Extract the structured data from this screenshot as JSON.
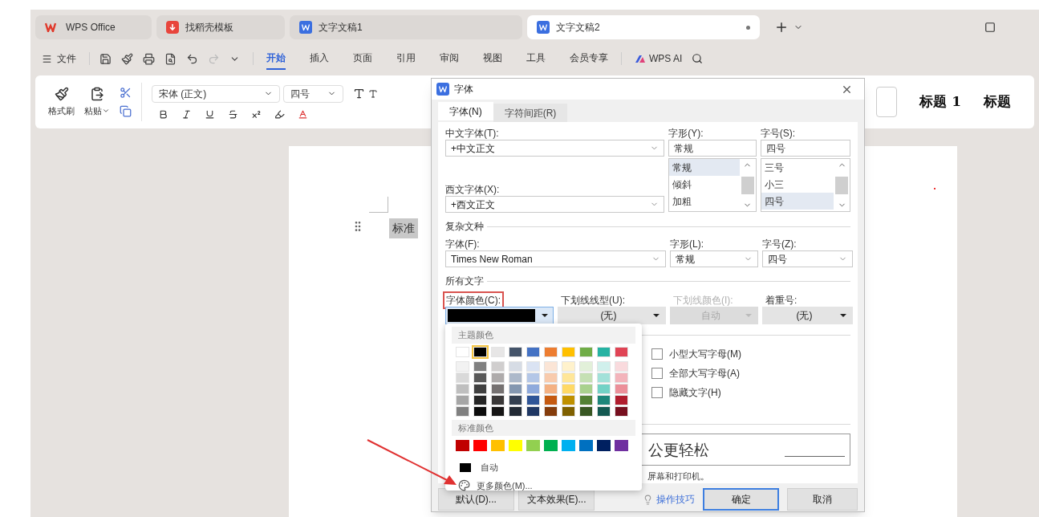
{
  "tabs": [
    {
      "label": "WPS Office",
      "kind": "home",
      "selected": false
    },
    {
      "label": "找稻壳模板",
      "kind": "template",
      "selected": false
    },
    {
      "label": "文字文稿1",
      "kind": "doc",
      "selected": false
    },
    {
      "label": "文字文稿2",
      "kind": "doc",
      "selected": true
    }
  ],
  "menu": {
    "file": "文件",
    "items": [
      {
        "label": "开始",
        "selected": true
      },
      {
        "label": "插入",
        "selected": false
      },
      {
        "label": "页面",
        "selected": false
      },
      {
        "label": "引用",
        "selected": false
      },
      {
        "label": "审阅",
        "selected": false
      },
      {
        "label": "视图",
        "selected": false
      },
      {
        "label": "工具",
        "selected": false
      },
      {
        "label": "会员专享",
        "selected": false
      }
    ],
    "ai": "WPS AI"
  },
  "ribbon": {
    "format_painter": "格式刷",
    "paste": "粘贴",
    "font_name": "宋体 (正文)",
    "font_size": "四号",
    "styles": [
      "标题 1",
      "标题"
    ]
  },
  "document": {
    "text": "标准"
  },
  "dialog": {
    "title": "字体",
    "tabs": [
      {
        "label": "字体(N)",
        "selected": true
      },
      {
        "label": "字符间距(R)",
        "selected": false
      }
    ],
    "cn_font": {
      "label": "中文字体(T):",
      "value": "+中文正文"
    },
    "style": {
      "label": "字形(Y):",
      "value": "常规",
      "options": [
        {
          "label": "常规",
          "selected": true
        },
        {
          "label": "倾斜",
          "selected": false
        },
        {
          "label": "加粗",
          "selected": false
        }
      ]
    },
    "size": {
      "label": "字号(S):",
      "value": "四号",
      "options": [
        {
          "label": "三号",
          "selected": false
        },
        {
          "label": "小三",
          "selected": false
        },
        {
          "label": "四号",
          "selected": true
        }
      ]
    },
    "west_font": {
      "label": "西文字体(X):",
      "value": "+西文正文"
    },
    "complex": {
      "heading": "复杂文种",
      "fields": [
        {
          "label": "字体(F):",
          "value": "Times New Roman"
        },
        {
          "label": "字形(L):",
          "value": "常规"
        },
        {
          "label": "字号(Z):",
          "value": "四号"
        }
      ]
    },
    "all_text": {
      "heading": "所有文字",
      "fields": [
        {
          "kind": "color",
          "label": "字体颜色(C):",
          "color": "#000000",
          "annotated": true,
          "disabled": false
        },
        {
          "kind": "select",
          "label": "下划线线型(U):",
          "value": "(无)",
          "annotated": false,
          "disabled": false
        },
        {
          "kind": "select",
          "label": "下划线颜色(I):",
          "value": "自动",
          "annotated": false,
          "disabled": true
        },
        {
          "kind": "select",
          "label": "着重号:",
          "value": "(无)",
          "annotated": false,
          "disabled": false
        }
      ]
    },
    "effects": [
      {
        "label": "小型大写字母(M)",
        "checked": false
      },
      {
        "label": "全部大写字母(A)",
        "checked": false
      },
      {
        "label": "隐藏文字(H)",
        "checked": false
      }
    ],
    "preview": {
      "text": "公更轻松",
      "hint": "屏幕和打印机。"
    },
    "buttons": [
      {
        "label": "默认(D)...",
        "kind": "plain"
      },
      {
        "label": "文本效果(E)...",
        "kind": "plain"
      },
      {
        "label": "操作技巧",
        "kind": "link"
      },
      {
        "label": "确定",
        "kind": "primary"
      },
      {
        "label": "取消",
        "kind": "plain"
      }
    ]
  },
  "color_menu": {
    "theme_heading": "主题颜色",
    "theme_rows": [
      [
        {
          "color": "#ffffff",
          "selected": false
        },
        {
          "color": "#000000",
          "selected": true
        },
        {
          "color": "#e7e6e6",
          "selected": false
        },
        {
          "color": "#44546a",
          "selected": false
        },
        {
          "color": "#4472c4",
          "selected": false
        },
        {
          "color": "#ed7d31",
          "selected": false
        },
        {
          "color": "#ffc000",
          "selected": false
        },
        {
          "color": "#70ad47",
          "selected": false
        },
        {
          "color": "#26b3a3",
          "selected": false
        },
        {
          "color": "#e04455",
          "selected": false
        }
      ],
      [
        {
          "color": "#f2f2f2",
          "selected": false
        },
        {
          "color": "#808080",
          "selected": false
        },
        {
          "color": "#d0cece",
          "selected": false
        },
        {
          "color": "#d6dce5",
          "selected": false
        },
        {
          "color": "#dae3f3",
          "selected": false
        },
        {
          "color": "#fbe5d6",
          "selected": false
        },
        {
          "color": "#fff2cc",
          "selected": false
        },
        {
          "color": "#e2f0d9",
          "selected": false
        },
        {
          "color": "#d0f0ec",
          "selected": false
        },
        {
          "color": "#f9dadd",
          "selected": false
        }
      ],
      [
        {
          "color": "#d9d9d9",
          "selected": false
        },
        {
          "color": "#595959",
          "selected": false
        },
        {
          "color": "#aeabab",
          "selected": false
        },
        {
          "color": "#adb9ca",
          "selected": false
        },
        {
          "color": "#b4c7e7",
          "selected": false
        },
        {
          "color": "#f8cbad",
          "selected": false
        },
        {
          "color": "#ffe699",
          "selected": false
        },
        {
          "color": "#c5e0b4",
          "selected": false
        },
        {
          "color": "#a2e1d9",
          "selected": false
        },
        {
          "color": "#f3b4bb",
          "selected": false
        }
      ],
      [
        {
          "color": "#bfbfbf",
          "selected": false
        },
        {
          "color": "#404040",
          "selected": false
        },
        {
          "color": "#757171",
          "selected": false
        },
        {
          "color": "#8497b0",
          "selected": false
        },
        {
          "color": "#8faadc",
          "selected": false
        },
        {
          "color": "#f4b183",
          "selected": false
        },
        {
          "color": "#ffd966",
          "selected": false
        },
        {
          "color": "#a9d18e",
          "selected": false
        },
        {
          "color": "#73d2c6",
          "selected": false
        },
        {
          "color": "#ec8f99",
          "selected": false
        }
      ],
      [
        {
          "color": "#a6a6a6",
          "selected": false
        },
        {
          "color": "#262626",
          "selected": false
        },
        {
          "color": "#3a3838",
          "selected": false
        },
        {
          "color": "#333f50",
          "selected": false
        },
        {
          "color": "#2f5597",
          "selected": false
        },
        {
          "color": "#c55a11",
          "selected": false
        },
        {
          "color": "#bf9000",
          "selected": false
        },
        {
          "color": "#538135",
          "selected": false
        },
        {
          "color": "#1d867a",
          "selected": false
        },
        {
          "color": "#b01c2d",
          "selected": false
        }
      ],
      [
        {
          "color": "#808080",
          "selected": false
        },
        {
          "color": "#0d0d0d",
          "selected": false
        },
        {
          "color": "#171616",
          "selected": false
        },
        {
          "color": "#222a35",
          "selected": false
        },
        {
          "color": "#203864",
          "selected": false
        },
        {
          "color": "#843c0c",
          "selected": false
        },
        {
          "color": "#7f6000",
          "selected": false
        },
        {
          "color": "#385723",
          "selected": false
        },
        {
          "color": "#135951",
          "selected": false
        },
        {
          "color": "#760f1e",
          "selected": false
        }
      ]
    ],
    "standard_heading": "标准颜色",
    "standard": [
      {
        "color": "#c00000",
        "selected": false
      },
      {
        "color": "#ff0000",
        "selected": false
      },
      {
        "color": "#ffc000",
        "selected": false
      },
      {
        "color": "#ffff00",
        "selected": false
      },
      {
        "color": "#92d050",
        "selected": false
      },
      {
        "color": "#00b050",
        "selected": false
      },
      {
        "color": "#00b0f0",
        "selected": false
      },
      {
        "color": "#0070c0",
        "selected": false
      },
      {
        "color": "#002060",
        "selected": false
      },
      {
        "color": "#7030a0",
        "selected": false
      }
    ],
    "auto": {
      "label": "自动",
      "color": "#000000"
    },
    "more": "更多颜色(M)..."
  }
}
